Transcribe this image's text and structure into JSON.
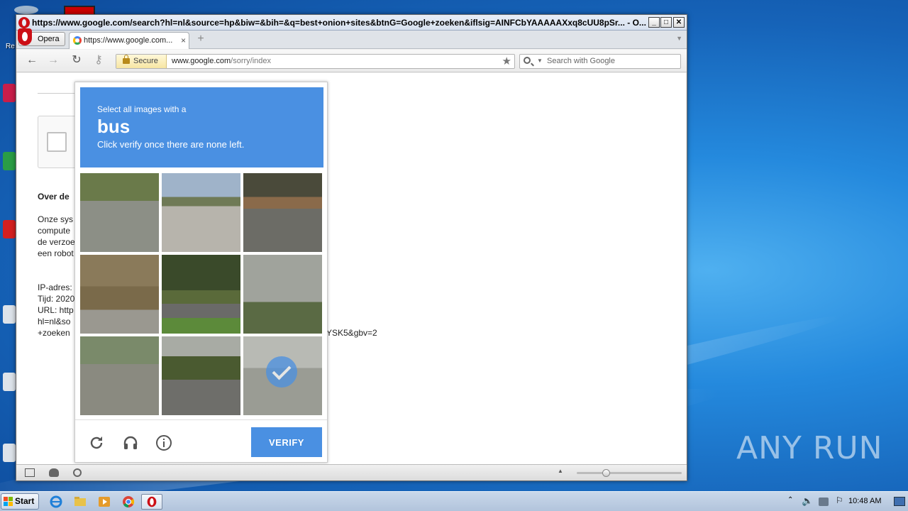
{
  "browser": {
    "title": "https://www.google.com/search?hl=nl&source=hp&biw=&bih=&q=best+onion+sites&btnG=Google+zoeken&iflsig=AINFCbYAAAAAXxq8cUU8pSr... - O...",
    "menu_label": "Opera",
    "tab_title": "https://www.google.com...",
    "tab_close": "×",
    "new_tab": "+",
    "secure_label": "Secure",
    "url_domain": "www.google.com",
    "url_path": "/sorry/index",
    "search_placeholder": "Search with Google"
  },
  "page": {
    "heading": "Over de",
    "paragraph": [
      "Onze sys",
      "compute",
      "de verzoe",
      "een robot"
    ],
    "info": [
      "IP-adres:",
      "Tijd: 2020",
      "URL: http",
      "hl=nl&so",
      "+zoeken"
    ],
    "url_tail": "YSK5&gbv=2"
  },
  "captcha": {
    "instruction_prefix": "Select all images with a",
    "target": "bus",
    "instruction_suffix": "Click verify once there are none left.",
    "verify_label": "VERIFY",
    "tiles": [
      {
        "name": "tile-suv-street",
        "selected": false
      },
      {
        "name": "tile-highway-bridge",
        "selected": false
      },
      {
        "name": "tile-silver-car",
        "selected": false
      },
      {
        "name": "tile-trees-road",
        "selected": false
      },
      {
        "name": "tile-traffic-cone",
        "selected": false
      },
      {
        "name": "tile-palm-trees",
        "selected": false
      },
      {
        "name": "tile-white-truck",
        "selected": false
      },
      {
        "name": "tile-road-trees",
        "selected": false
      },
      {
        "name": "tile-street-selected",
        "selected": true
      }
    ]
  },
  "taskbar": {
    "start_label": "Start",
    "clock": "10:48 AM"
  },
  "watermark": "ANY RUN",
  "colors": {
    "captcha_blue": "#4a90e2",
    "opera_red": "#cc0f16"
  }
}
